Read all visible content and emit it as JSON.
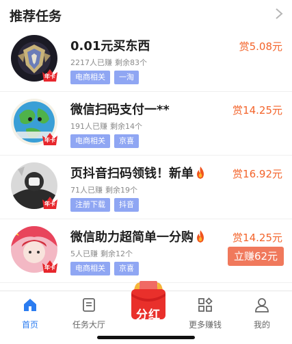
{
  "header": {
    "title": "推荐任务"
  },
  "vip_badge_text": "年卡",
  "tasks": [
    {
      "title": "0.01元买东西",
      "has_fire": false,
      "participants": "2217人已赚",
      "remaining": "剩余83个",
      "tags": [
        "电商相关",
        "一淘"
      ],
      "reward": "赏5.08元",
      "cta": ""
    },
    {
      "title": "微信扫码支付一**",
      "has_fire": false,
      "participants": "191人已赚",
      "remaining": "剩余14个",
      "tags": [
        "电商相关",
        "京喜"
      ],
      "reward": "赏14.25元",
      "cta": ""
    },
    {
      "title": "页抖音扫码领钱！新单",
      "has_fire": true,
      "participants": "71人已赚",
      "remaining": "剩余19个",
      "tags": [
        "注册下载",
        "抖音"
      ],
      "reward": "赏16.92元",
      "cta": ""
    },
    {
      "title": "微信助力超简单一分购",
      "has_fire": true,
      "participants": "5人已赚",
      "remaining": "剩余12个",
      "tags": [
        "电商相关",
        "京喜"
      ],
      "reward": "赏14.25元",
      "cta": "立赚62元"
    }
  ],
  "tabbar": {
    "home": "首页",
    "task_hall": "任务大厅",
    "fenhong": "分红",
    "more": "更多赚钱",
    "mine": "我的"
  },
  "colors": {
    "accent": "#2b7cf0",
    "reward": "#f3632a",
    "tag_bg": "#8fa6f3",
    "cta_bg": "#f0795c"
  }
}
